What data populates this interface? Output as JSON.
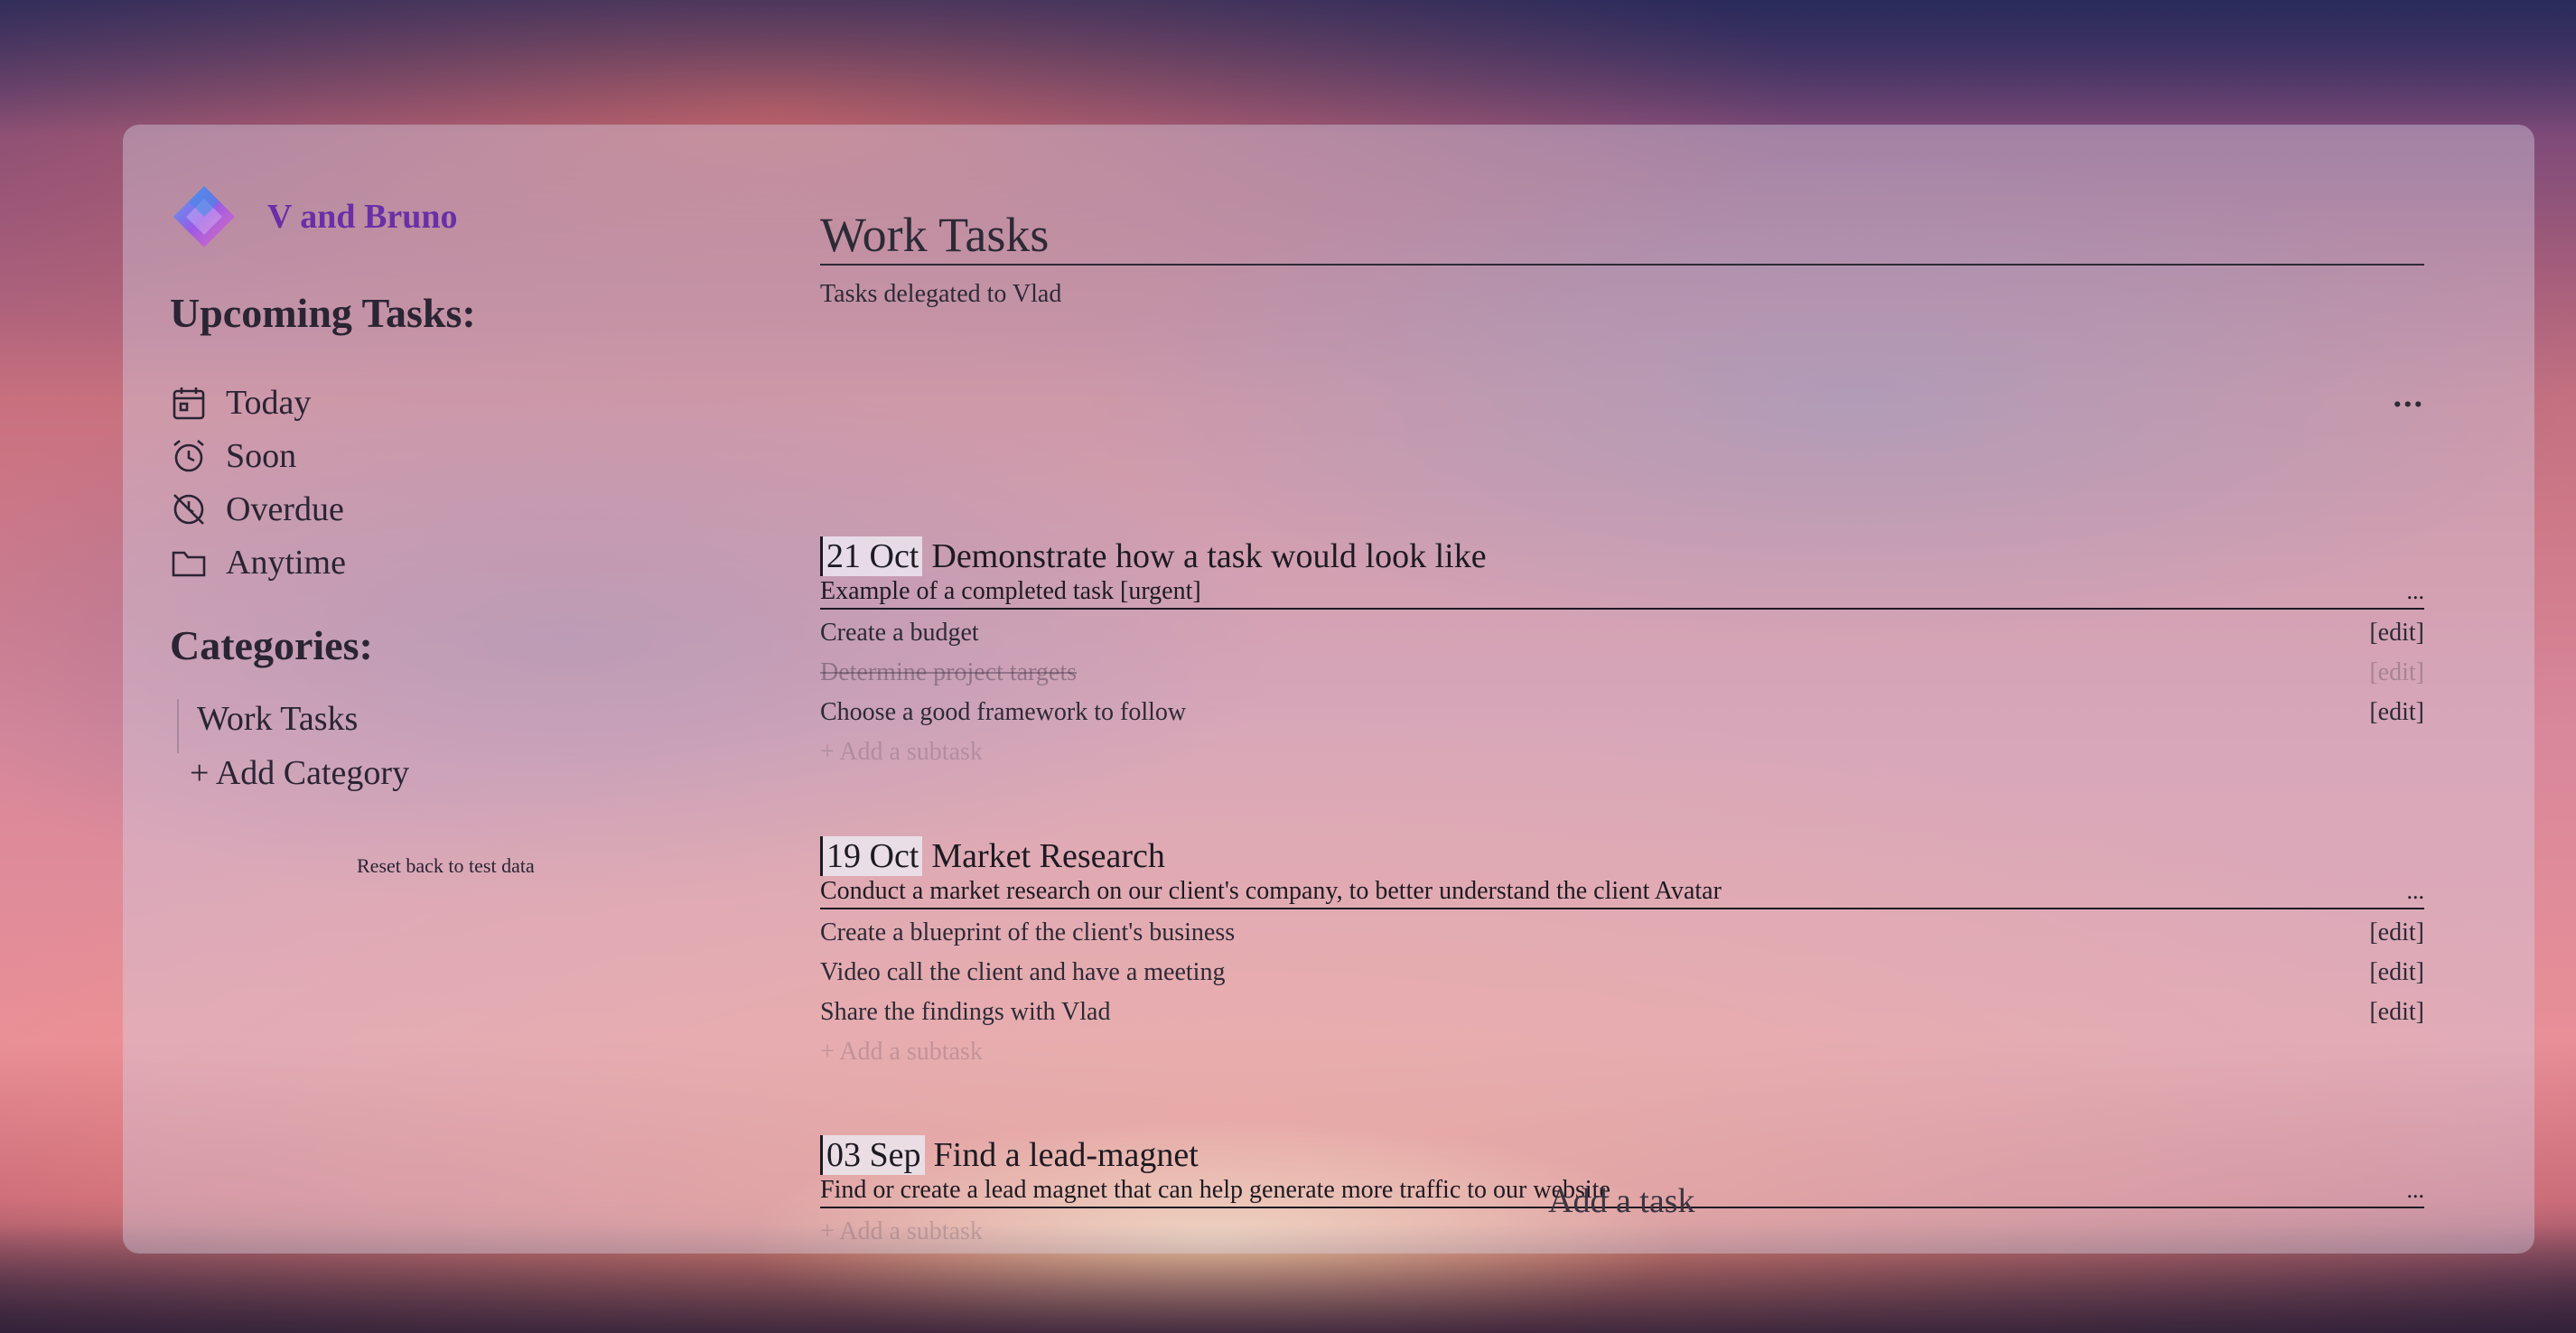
{
  "brand": {
    "name": "V and Bruno",
    "logo_icon": "diamond-logo-icon"
  },
  "sidebar": {
    "upcoming_title": "Upcoming Tasks:",
    "upcoming": [
      {
        "label": "Today",
        "icon": "calendar-icon"
      },
      {
        "label": "Soon",
        "icon": "alarm-clock-icon"
      },
      {
        "label": "Overdue",
        "icon": "clock-off-icon"
      },
      {
        "label": "Anytime",
        "icon": "folder-icon"
      }
    ],
    "categories_title": "Categories:",
    "categories": [
      {
        "label": "Work Tasks"
      }
    ],
    "add_category": "+ Add Category",
    "reset": "Reset back to test data"
  },
  "main": {
    "title": "Work Tasks",
    "subtitle": "Tasks delegated to Vlad",
    "more": "...",
    "tasks": [
      {
        "date": "21 Oct",
        "title": "Demonstrate how a task would look like",
        "description": "Example of a completed task [urgent]",
        "menu": "...",
        "subtasks": [
          {
            "label": "Create a budget",
            "edit": "[edit]",
            "done": false
          },
          {
            "label": "Determine project targets",
            "edit": "[edit]",
            "done": true
          },
          {
            "label": "Choose a good framework to follow",
            "edit": "[edit]",
            "done": false
          }
        ],
        "add_subtask": "+ Add a subtask"
      },
      {
        "date": "19 Oct",
        "title": "Market Research",
        "description": "Conduct a market research on our client's company, to better understand the client Avatar",
        "menu": "...",
        "subtasks": [
          {
            "label": "Create a blueprint of the client's business",
            "edit": "[edit]",
            "done": false
          },
          {
            "label": "Video call the client and have a meeting",
            "edit": "[edit]",
            "done": false
          },
          {
            "label": "Share the findings with Vlad",
            "edit": "[edit]",
            "done": false
          }
        ],
        "add_subtask": "+ Add a subtask"
      },
      {
        "date": "03 Sep",
        "title": "Find a lead-magnet",
        "description": "Find or create a lead magnet that can help generate more traffic to our website",
        "menu": "...",
        "subtasks": [],
        "add_subtask": "+ Add a subtask"
      }
    ],
    "add_task": "Add a task"
  },
  "colors": {
    "brand": "#6a2fa8",
    "text": "#2a2433"
  }
}
